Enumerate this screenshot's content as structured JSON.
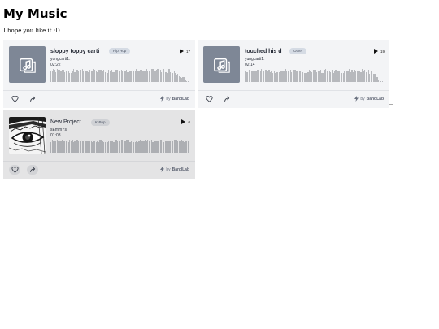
{
  "page": {
    "title": "My Music",
    "subtitle": "I hope you like it :D"
  },
  "tracks": [
    {
      "title": "sloppy toppy carti",
      "genre": "Hip Hop",
      "artist": "yungcarti1.",
      "duration": "02:22",
      "plays": "17",
      "cover": "music-note-placeholder-icon"
    },
    {
      "title": "touched his d",
      "genre": "Other",
      "artist": "yungcarti1.",
      "duration": "02:14",
      "plays": "19",
      "cover": "music-note-placeholder-icon"
    },
    {
      "title": "New Project",
      "genre": "K-Pop",
      "artist": "sEmmYs.",
      "duration": "01:03",
      "plays": "0",
      "cover": "manga-eye-artwork"
    }
  ],
  "footer": {
    "by": "by",
    "brand": "BandLab"
  },
  "icons": {
    "like": "heart-icon",
    "share": "share-arrow-icon",
    "play": "play-icon",
    "bolt": "bolt-icon"
  },
  "colors": {
    "card_background": "#f3f4f6",
    "card_background_active": "#e4e4e5",
    "cover_placeholder": "#7e8796",
    "waveform": "#b7b9bd",
    "badge": "#d5dbe4"
  }
}
